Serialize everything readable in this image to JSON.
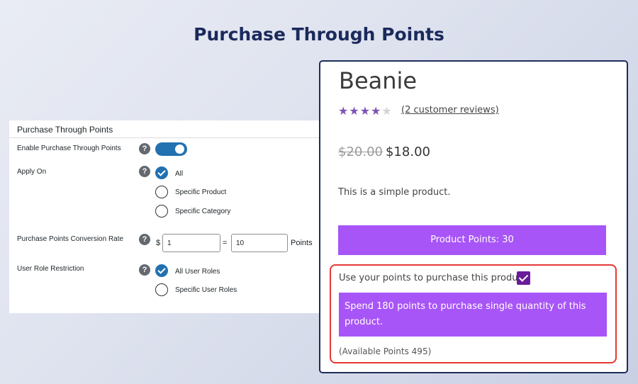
{
  "hero": {
    "title": "Purchase Through Points"
  },
  "settings": {
    "header": "Purchase Through Points",
    "enable_label": "Enable Purchase Through Points",
    "enable_value": true,
    "apply_on_label": "Apply On",
    "apply_on_options": [
      "All",
      "Specific Product",
      "Specific Category"
    ],
    "apply_on_selected": "All",
    "conversion_label": "Purchase Points Conversion Rate",
    "currency_symbol": "$",
    "conversion_amount": "1",
    "equals": "=",
    "conversion_points": "10",
    "points_unit": "Points",
    "role_label": "User Role Restriction",
    "role_options": [
      "All User Roles",
      "Specific User Roles"
    ],
    "role_selected": "All User Roles",
    "help_glyph": "?"
  },
  "product": {
    "title": "Beanie",
    "rating": 4,
    "rating_max": 5,
    "reviews_link": "(2 customer reviews)",
    "price_old": "$20.00",
    "price_new": "$18.00",
    "description": "This is a simple product.",
    "points_button": "Product Points: 30",
    "use_points_text": "Use your points to purchase this product",
    "use_points_checked": true,
    "spend_message": "Spend 180 points to purchase single quantity of this product.",
    "available_points": "(Available Points 495)"
  },
  "colors": {
    "hero_title": "#1b2a5c",
    "wp_blue": "#2271b1",
    "purple": "#a855f7",
    "star": "#7f54b3",
    "highlight_border": "#e53935",
    "check_purple": "#6a1b9a"
  },
  "icons": {
    "help": "help-icon",
    "star": "star-icon",
    "check": "checkmark-icon"
  }
}
